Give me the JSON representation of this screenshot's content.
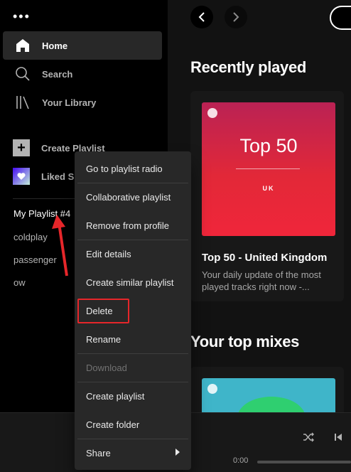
{
  "sidebar": {
    "menu_dots": "•••",
    "nav": [
      {
        "label": "Home",
        "icon": "home-icon"
      },
      {
        "label": "Search",
        "icon": "search-icon"
      },
      {
        "label": "Your Library",
        "icon": "library-icon"
      }
    ],
    "create_playlist": "Create Playlist",
    "liked_songs": "Liked S",
    "playlists": [
      "My Playlist #4",
      "coldplay",
      "passenger",
      "ow"
    ]
  },
  "main": {
    "recently_played_title": "Recently played",
    "card": {
      "art_title": "Top 50",
      "art_subtitle": "UK",
      "title": "Top 50 - United Kingdom",
      "description": "Your daily update of the most played tracks right now -..."
    },
    "top_mixes_title": "Your top mixes"
  },
  "player": {
    "time_elapsed": "0:00"
  },
  "context_menu": {
    "items": [
      {
        "label": "Go to playlist radio"
      },
      {
        "label": "Collaborative playlist"
      },
      {
        "label": "Remove from profile"
      },
      {
        "label": "Edit details"
      },
      {
        "label": "Create similar playlist"
      },
      {
        "label": "Delete"
      },
      {
        "label": "Rename"
      },
      {
        "label": "Download"
      },
      {
        "label": "Create playlist"
      },
      {
        "label": "Create folder"
      },
      {
        "label": "Share"
      }
    ]
  },
  "colors": {
    "accent_annotation": "#e6262a",
    "card_art_red": "#e22838",
    "menu_bg": "#282828"
  }
}
